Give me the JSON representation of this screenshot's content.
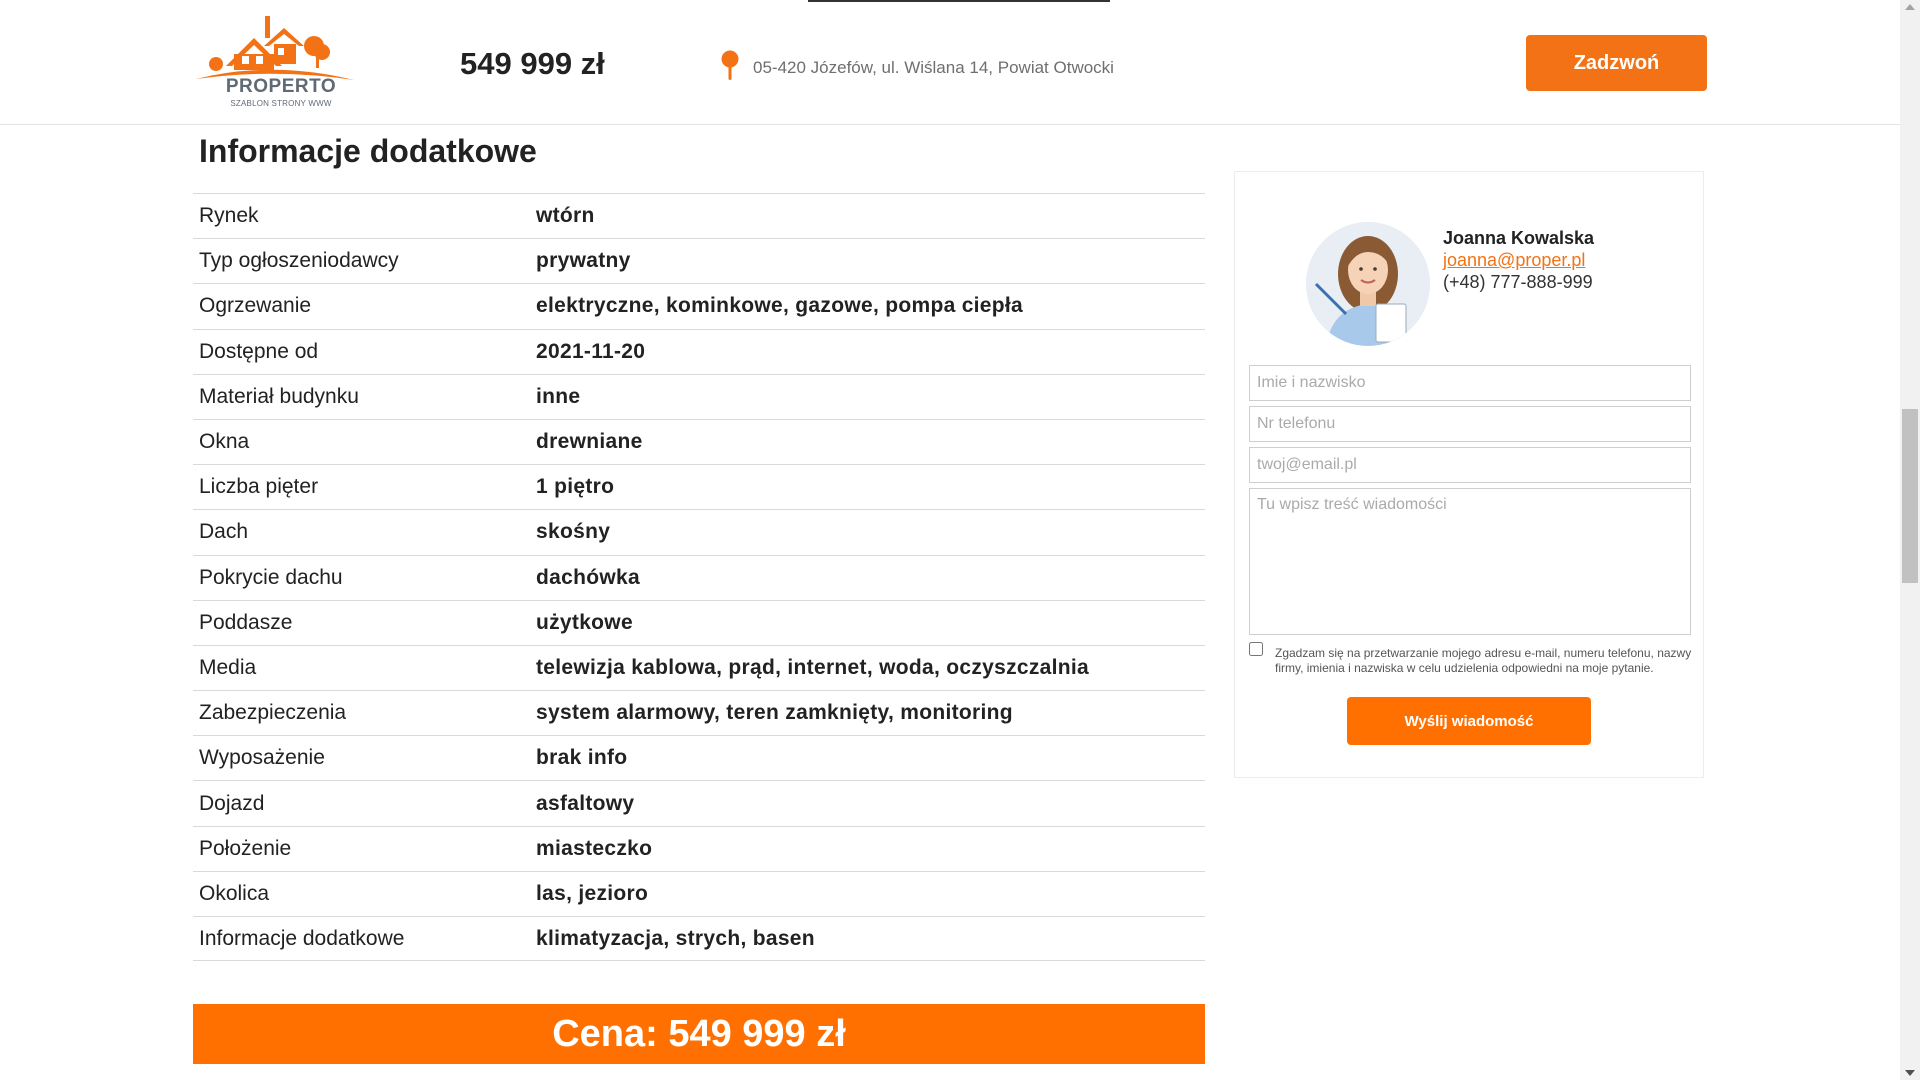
{
  "header": {
    "logo_name": "PROPERTO",
    "logo_sub": "SZABLON STRONY WWW",
    "price": "549 999 zł",
    "address": "05-420 Józefów, ul. Wiślana 14, Powiat Otwocki",
    "call_label": "Zadzwoń",
    "accent_color": "#f37215"
  },
  "section": {
    "title": "Informacje dodatkowe"
  },
  "details": [
    {
      "label": "Rynek",
      "value": "wtórn"
    },
    {
      "label": "Typ ogłoszeniodawcy",
      "value": "prywatny"
    },
    {
      "label": "Ogrzewanie",
      "value": "elektryczne, kominkowe, gazowe, pompa ciepła"
    },
    {
      "label": "Dostępne od",
      "value": "2021-11-20"
    },
    {
      "label": "Materiał budynku",
      "value": "inne"
    },
    {
      "label": "Okna",
      "value": "drewniane"
    },
    {
      "label": "Liczba pięter",
      "value": "1 piętro"
    },
    {
      "label": "Dach",
      "value": "skośny"
    },
    {
      "label": "Pokrycie dachu",
      "value": "dachówka"
    },
    {
      "label": "Poddasze",
      "value": "użytkowe"
    },
    {
      "label": "Media",
      "value": "telewizja kablowa, prąd, internet, woda, oczyszczalnia"
    },
    {
      "label": "Zabezpieczenia",
      "value": "system alarmowy, teren zamknięty, monitoring"
    },
    {
      "label": "Wyposażenie",
      "value": "brak info"
    },
    {
      "label": "Dojazd",
      "value": "asfaltowy"
    },
    {
      "label": "Położenie",
      "value": "miasteczko"
    },
    {
      "label": "Okolica",
      "value": "las, jezioro"
    },
    {
      "label": "Informacje dodatkowe",
      "value": "klimatyzacja, strych, basen"
    }
  ],
  "price_banner": "Cena: 549 999 zł",
  "agent": {
    "name": "Joanna Kowalska",
    "email": "joanna@proper.pl",
    "phone": "(+48) 777-888-999"
  },
  "form": {
    "name_placeholder": "Imie i nazwisko",
    "phone_placeholder": "Nr telefonu",
    "email_placeholder": "twoj@email.pl",
    "message_placeholder": "Tu wpisz treść wiadomości",
    "consent": "Zgadzam się na przetwarzanie mojego adresu e-mail, numeru telefonu, nazwy firmy, imienia i nazwiska w celu udzielenia odpowiedni na moje pytanie.",
    "submit_label": "Wyślij wiadomość"
  }
}
